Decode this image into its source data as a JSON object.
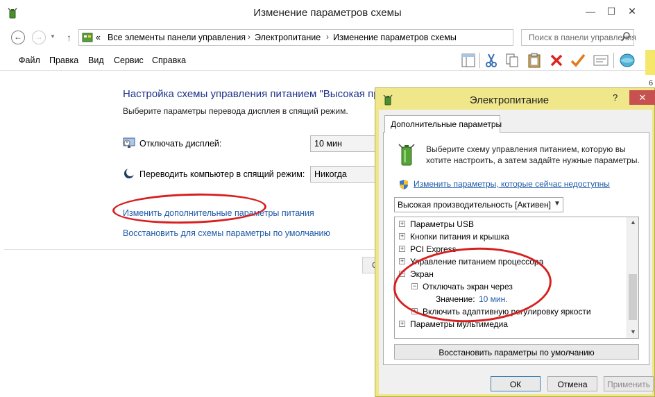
{
  "main_window": {
    "title": "Изменение параметров схемы",
    "controls": {
      "minimize": "—",
      "maximize": "☐",
      "close": "✕"
    },
    "nav": {
      "back": "←",
      "forward": "→",
      "up": "↑"
    },
    "address": {
      "prefix": "«",
      "crumbs": [
        "Все элементы панели управления",
        "Электропитание",
        "Изменение параметров схемы"
      ],
      "separator": "›",
      "dropdown": "▾",
      "refresh": "↻"
    },
    "search": {
      "placeholder": "Поиск в панели управления"
    },
    "menu": [
      "Файл",
      "Правка",
      "Вид",
      "Сервис",
      "Справка"
    ],
    "toolbar_icons": [
      "layout-icon",
      "cut-icon",
      "copy-icon",
      "paste-icon",
      "delete-icon",
      "check-icon",
      "properties-icon",
      "globe-icon"
    ],
    "side_text": "6"
  },
  "plan_settings": {
    "title": "Настройка схемы управления питанием \"Высокая пр",
    "subtitle": "Выберите параметры перевода дисплея в спящий режим.",
    "rows": [
      {
        "icon": "display-icon",
        "label": "Отключать дисплей:",
        "value": "10 мин"
      },
      {
        "icon": "sleep-icon",
        "label": "Переводить компьютер в спящий режим:",
        "value": "Никогда"
      }
    ],
    "links": {
      "advanced": "Изменить дополнительные параметры питания",
      "restore": "Восстановить для схемы параметры по умолчанию"
    },
    "hidden_button_fragment": "С"
  },
  "dialog": {
    "title": "Электропитание",
    "help": "?",
    "close": "✕",
    "tab": "Дополнительные параметры",
    "description": "Выберите схему управления питанием, которую вы хотите настроить, а затем задайте нужные параметры.",
    "change_link": "Изменить параметры, которые сейчас недоступны",
    "scheme": "Высокая производительность [Активен]",
    "tree": [
      {
        "label": "Параметры USB",
        "box": "+",
        "indent": 0
      },
      {
        "label": "Кнопки питания и крышка",
        "box": "+",
        "indent": 0
      },
      {
        "label": "PCI Express",
        "box": "+",
        "indent": 0
      },
      {
        "label": "Управление питанием процессора",
        "box": "+",
        "indent": 0
      },
      {
        "label": "Экран",
        "box": "−",
        "indent": 0
      },
      {
        "label": "Отключать экран через",
        "box": "−",
        "indent": 1
      },
      {
        "label": "Значение:",
        "value": "10 мин.",
        "indent": 2
      },
      {
        "label": "Включить адаптивную регулировку яркости",
        "box": "+",
        "indent": 1
      },
      {
        "label": "Параметры мультимедиа",
        "box": "+",
        "indent": 0
      }
    ],
    "scroll": {
      "up": "▲",
      "down": "▼"
    },
    "restore_button": "Восстановить параметры по умолчанию",
    "buttons": {
      "ok": "ОК",
      "cancel": "Отмена",
      "apply": "Применить"
    }
  },
  "annotations": {
    "color": "#d81f1f"
  },
  "colors": {
    "title_blue": "#1e3287",
    "link_blue": "#1e5aa8",
    "dialog_frame": "#f0e68a",
    "close_red": "#c75050"
  }
}
